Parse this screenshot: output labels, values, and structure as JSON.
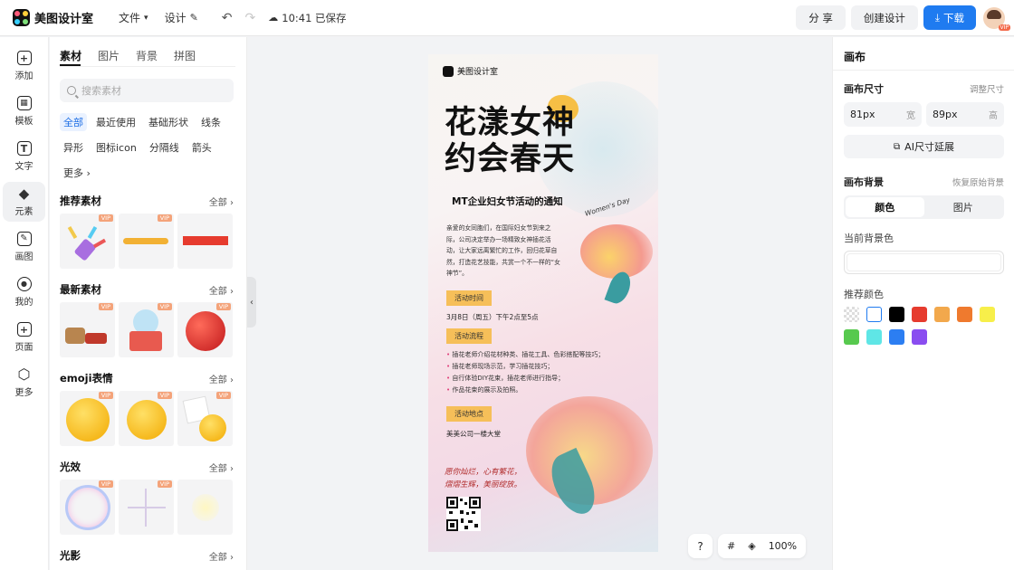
{
  "app": {
    "name": "美图设计室"
  },
  "menu": {
    "file": "文件",
    "design": "设计"
  },
  "save_status": "10:41 已保存",
  "top_actions": {
    "share": "分 享",
    "create": "创建设计",
    "download": "下载"
  },
  "user": {
    "vip_badge": "VIP"
  },
  "leftnav": [
    {
      "label": "添加",
      "icon": "plus-square-icon",
      "glyph": "+"
    },
    {
      "label": "模板",
      "icon": "template-grid-icon",
      "glyph": "▦"
    },
    {
      "label": "文字",
      "icon": "text-icon",
      "glyph": "T"
    },
    {
      "label": "元素",
      "icon": "shapes-icon",
      "glyph": "◆",
      "active": true
    },
    {
      "label": "画图",
      "icon": "pencil-icon",
      "glyph": "✎"
    },
    {
      "label": "我的",
      "icon": "user-icon",
      "glyph": "◉"
    },
    {
      "label": "页面",
      "icon": "page-add-icon",
      "glyph": "+"
    },
    {
      "label": "更多",
      "icon": "cube-icon",
      "glyph": "⬡"
    }
  ],
  "panel": {
    "tabs": [
      "素材",
      "图片",
      "背景",
      "拼图"
    ],
    "search_placeholder": "搜索素材",
    "chips": [
      "全部",
      "最近使用",
      "基础形状",
      "线条",
      "异形",
      "图标icon",
      "分隔线",
      "箭头",
      "更多 ›"
    ],
    "sections": [
      {
        "title": "推荐素材",
        "all": "全部 ›"
      },
      {
        "title": "最新素材",
        "all": "全部 ›"
      },
      {
        "title": "emoji表情",
        "all": "全部 ›"
      },
      {
        "title": "光效",
        "all": "全部 ›"
      },
      {
        "title": "光影",
        "all": "全部 ›"
      }
    ],
    "vip": "VIP"
  },
  "poster": {
    "logo": "美图设计室",
    "title_line1": "花漾女神",
    "title_line2": "约会春天",
    "subtitle": "MT企业妇女节活动的通知",
    "body": "亲爱的女同胞们，在国际妇女节到来之际，公司决定举办一场精致女神插花活动，让大家远离繁忙的工作，回归花草自然，打造花艺技能，共赏一个不一样的“女神节”。",
    "womens_day": "Women's Day",
    "tag_time": "活动时间",
    "time_text": "3月8日（周五）下午2点至5点",
    "tag_flow": "活动流程",
    "flow": [
      "插花老师介绍花材种类、插花工具、色彩搭配等技巧；",
      "插花老师现场示范，学习插花技巧；",
      "自行体验DIY花束，插花老师进行指导；",
      "作品花束的展示及拍照。"
    ],
    "tag_place": "活动地点",
    "place_text": "美美公司一楼大堂",
    "handwriting_1": "愿你灿烂，心有繁花，",
    "handwriting_2": "熠熠生辉，美丽绽放。"
  },
  "canvas": {
    "help": "?",
    "zoom": "100%"
  },
  "right": {
    "title": "画布",
    "size_label": "画布尺寸",
    "size_link": "调整尺寸",
    "width_value": "81px",
    "width_unit": "宽",
    "height_value": "89px",
    "height_unit": "高",
    "ai_button": "AI尺寸延展",
    "bg_label": "画布背景",
    "bg_link": "恢复原始背景",
    "seg_color": "颜色",
    "seg_image": "图片",
    "current_color_label": "当前背景色",
    "recommend_label": "推荐颜色",
    "swatches": [
      "transparent",
      "#ffffff",
      "#000000",
      "#e63b2e",
      "#f2a84c",
      "#ef7a2e",
      "#f7ef4a",
      "#57c94e",
      "#5fe6e6",
      "#2c7ef2",
      "#8a4df0"
    ]
  }
}
